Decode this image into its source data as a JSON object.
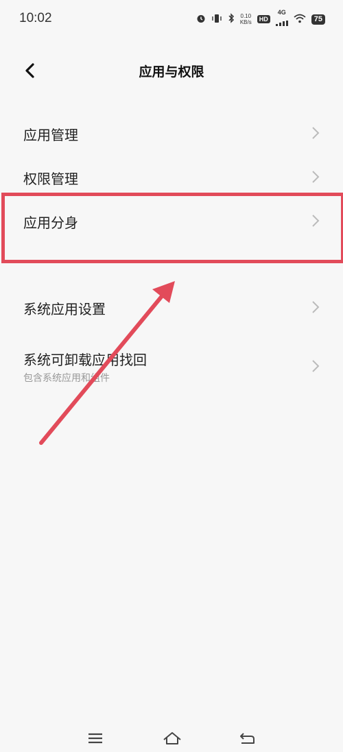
{
  "status": {
    "time": "10:02",
    "speed_value": "0.10",
    "speed_unit": "KB/s",
    "hd": "HD",
    "network": "4G",
    "battery": "75"
  },
  "header": {
    "title": "应用与权限"
  },
  "items": [
    {
      "label": "应用管理"
    },
    {
      "label": "权限管理"
    },
    {
      "label": "应用分身"
    },
    {
      "label": "系统应用设置"
    },
    {
      "label": "系统可卸载应用找回",
      "sublabel": "包含系统应用和组件"
    }
  ],
  "annotation": {
    "highlight_color": "#e24b5a"
  },
  "icons": {
    "back": "back-arrow-icon",
    "chevron": "chevron-right-icon",
    "menu": "menu-icon",
    "home": "home-icon",
    "return": "return-icon"
  }
}
